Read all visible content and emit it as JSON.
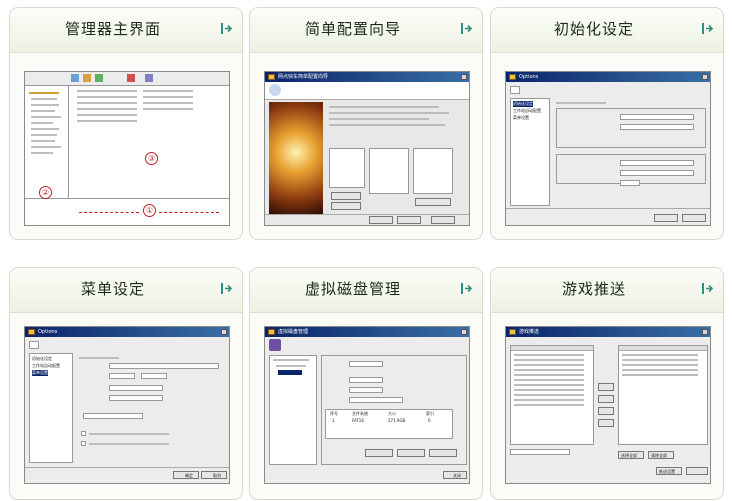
{
  "cards": [
    {
      "title": "管理器主界面",
      "markers": [
        "②",
        "③",
        "①"
      ]
    },
    {
      "title": "简单配置向导",
      "window_title": "网点快车简单配置向导"
    },
    {
      "title": "初始化设定",
      "window_title": "Options",
      "menu": [
        "初始化设定",
        "工作站自动配置",
        "菜单设置"
      ]
    },
    {
      "title": "菜单设定",
      "window_title": "Options",
      "menu": [
        "初始化设定",
        "工作站自动配置",
        "菜单设置"
      ],
      "ok_label": "确定",
      "cancel_label": "取消"
    },
    {
      "title": "虚拟磁盘管理",
      "window_title": "虚拟磁盘管理",
      "close_label": "关闭",
      "table_headers": [
        "序号",
        "文件系统",
        "大小",
        "索引"
      ],
      "table_row": [
        "1",
        "FAT16",
        "271.9GB",
        "0"
      ]
    },
    {
      "title": "游戏推送",
      "window_title": "游戏推送",
      "buttons": [
        "选择全部",
        "清除全部",
        "推送设置"
      ]
    }
  ],
  "colors": {
    "accent_arrow": "#2f8f83",
    "card_border": "#d6dcca"
  },
  "icons": {
    "card_arrow": "arrow-right-icon"
  }
}
